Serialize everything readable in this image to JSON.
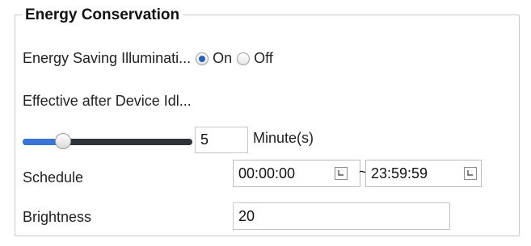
{
  "panel": {
    "title": "Energy Conservation"
  },
  "energy_saving": {
    "label": "Energy Saving Illuminati...",
    "options": [
      {
        "label": "On",
        "selected": true
      },
      {
        "label": "Off",
        "selected": false
      }
    ]
  },
  "effective_after": {
    "label": "Effective after Device Idl..."
  },
  "idle_time": {
    "value": "5",
    "unit": "Minute(s)",
    "slider_fraction": 0.19
  },
  "schedule": {
    "label": "Schedule",
    "start": "00:00:00",
    "separator": "~",
    "end": "23:59:59",
    "start_icon": "clock-icon",
    "end_icon": "clock-icon"
  },
  "brightness": {
    "label": "Brightness",
    "value": "20"
  },
  "colors": {
    "accent": "#3a74d6",
    "track": "#2f3338",
    "border": "#c9c9c9"
  }
}
